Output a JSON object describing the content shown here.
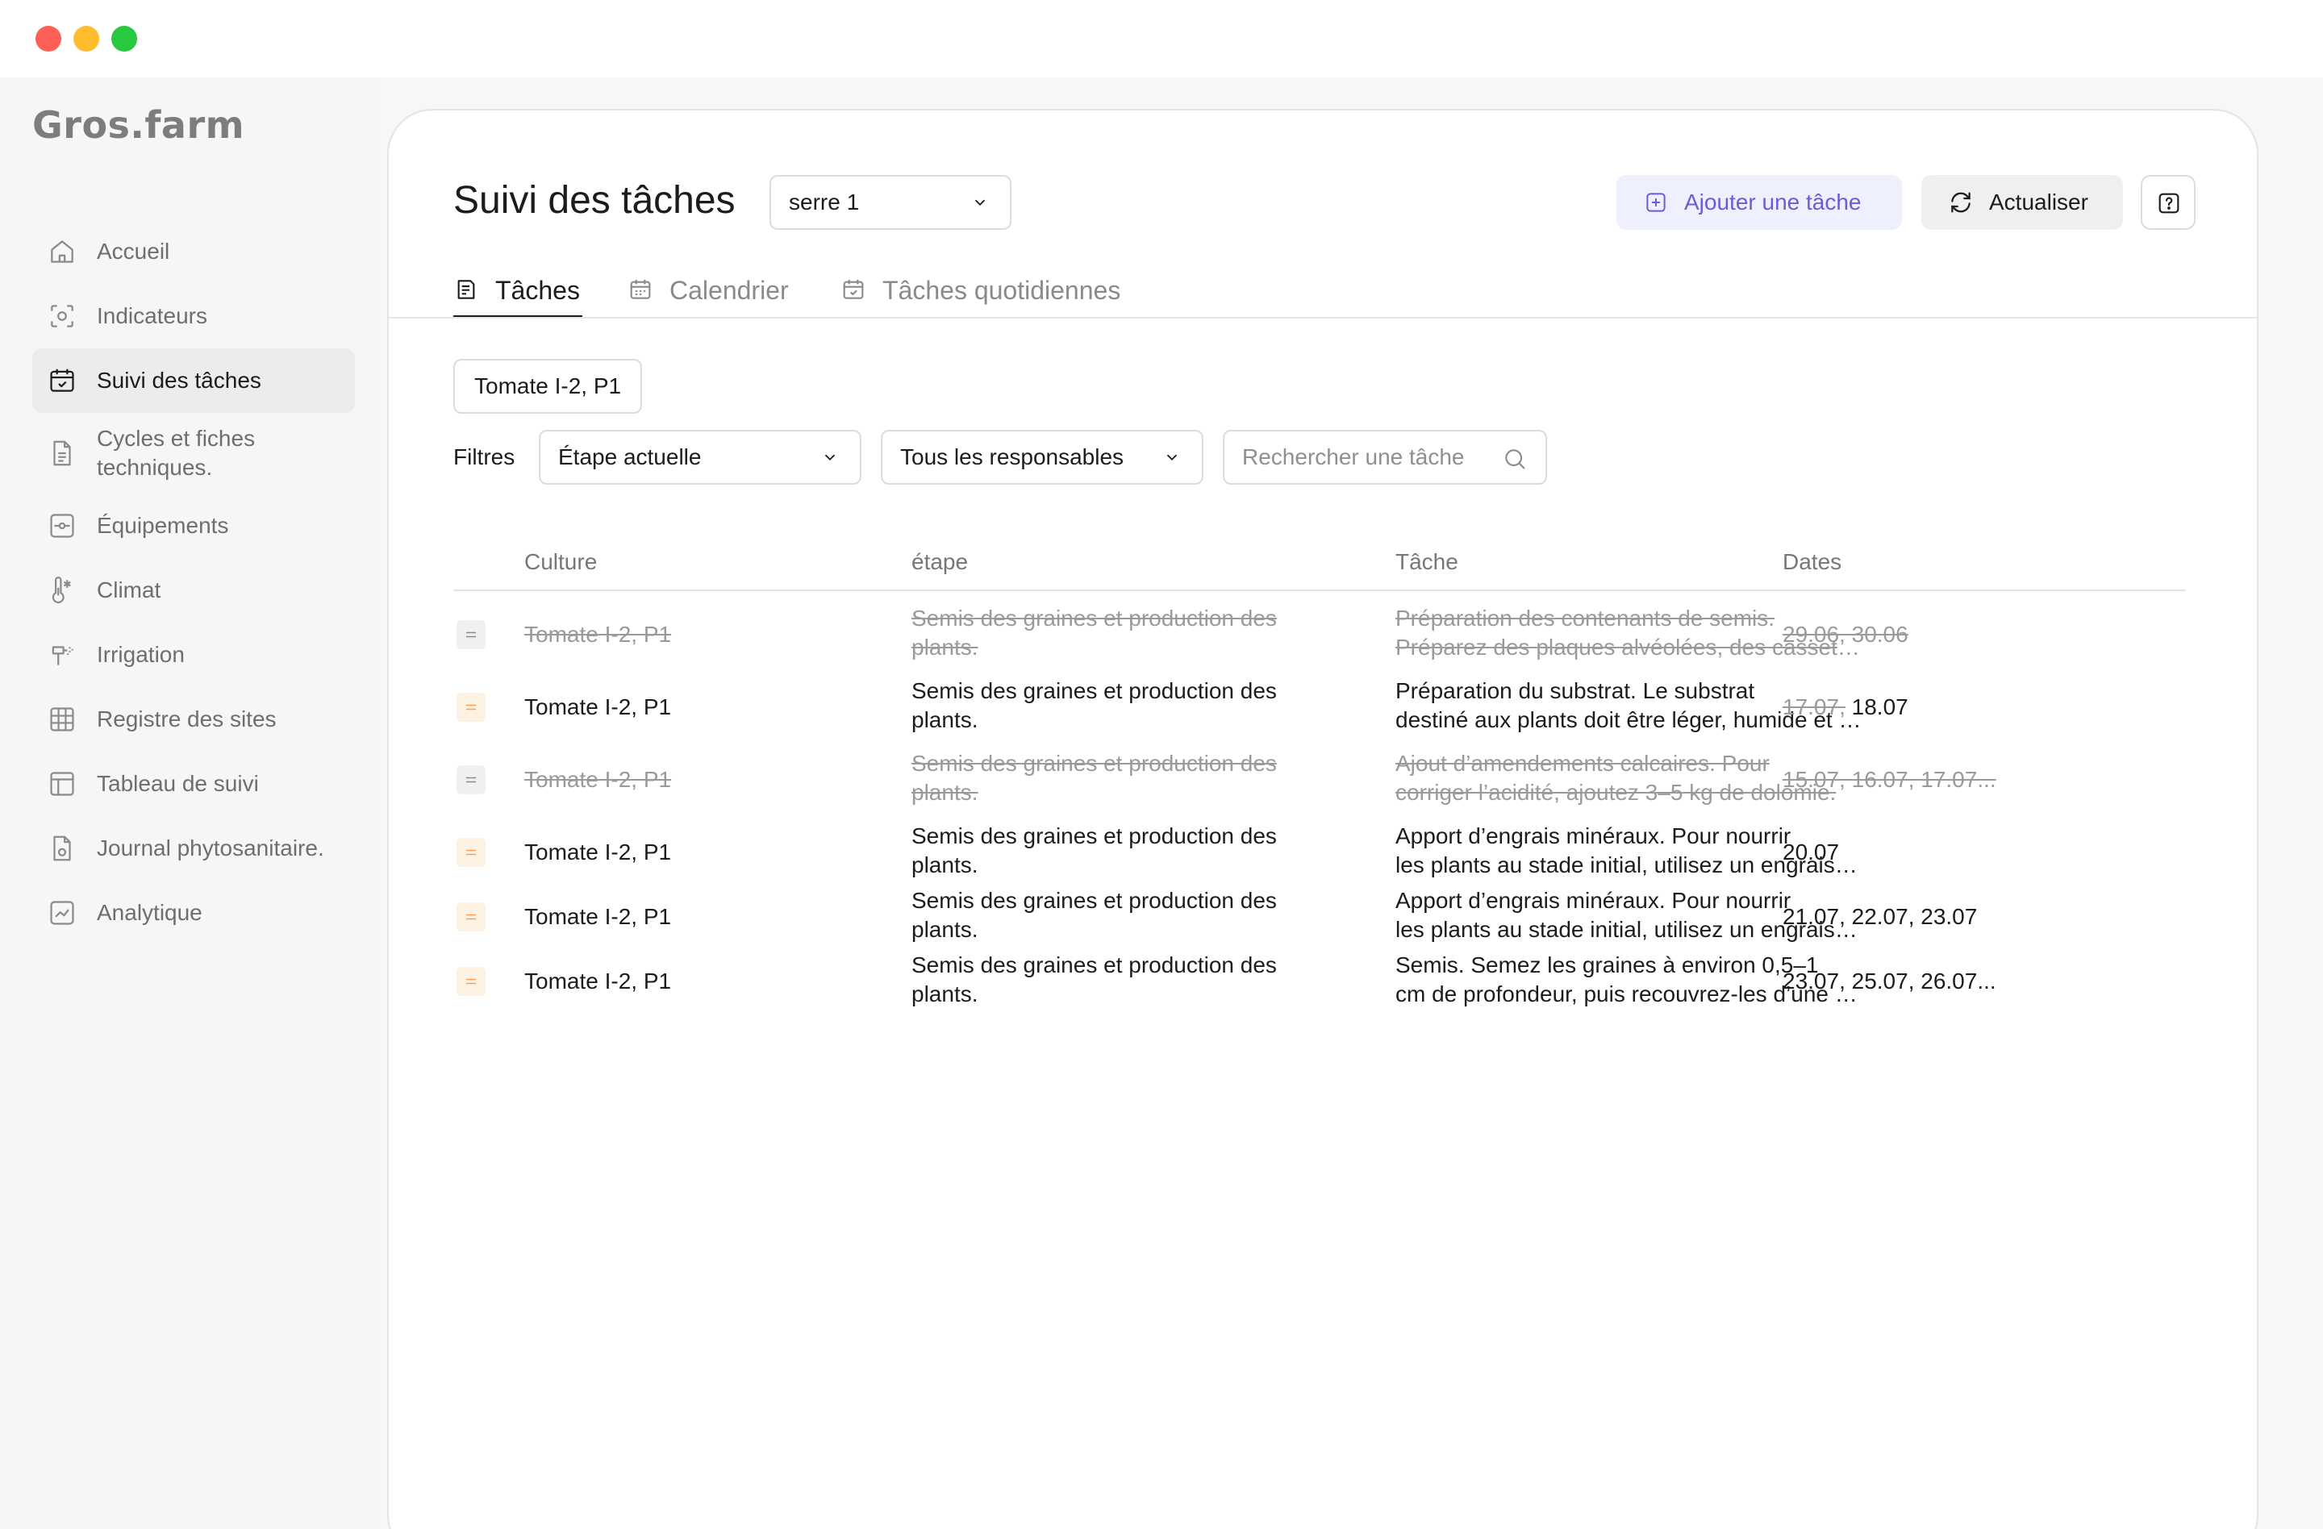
{
  "app": {
    "logo": "Gros.farm"
  },
  "sidebar": {
    "items": [
      {
        "label": "Accueil",
        "icon": "home-icon",
        "active": false
      },
      {
        "label": "Indicateurs",
        "icon": "indicators-icon",
        "active": false
      },
      {
        "label": "Suivi des tâches",
        "icon": "calendar-check-icon",
        "active": true
      },
      {
        "label": "Cycles et fiches\ntechniques.",
        "icon": "document-icon",
        "active": false
      },
      {
        "label": "Équipements",
        "icon": "equipment-icon",
        "active": false
      },
      {
        "label": "Climat",
        "icon": "thermometer-icon",
        "active": false
      },
      {
        "label": "Irrigation",
        "icon": "irrigation-icon",
        "active": false
      },
      {
        "label": "Registre des sites",
        "icon": "grid-icon",
        "active": false
      },
      {
        "label": "Tableau de suivi",
        "icon": "table-icon",
        "active": false
      },
      {
        "label": "Journal phytosanitaire.",
        "icon": "journal-icon",
        "active": false
      },
      {
        "label": "Analytique",
        "icon": "chart-icon",
        "active": false
      }
    ]
  },
  "header": {
    "title": "Suivi des tâches",
    "site_select": "serre 1",
    "add_task": "Ajouter une tâche",
    "refresh": "Actualiser",
    "help_icon": "help-icon"
  },
  "tabs": [
    {
      "label": "Tâches",
      "active": true
    },
    {
      "label": "Calendrier",
      "active": false
    },
    {
      "label": "Tâches quotidiennes",
      "active": false
    }
  ],
  "crop_chip": "Tomate I-2, P1",
  "filters": {
    "label": "Filtres",
    "stage": "Étape actuelle",
    "responsible": "Tous les responsables",
    "search_placeholder": "Rechercher une tâche"
  },
  "table": {
    "columns": [
      "Culture",
      "étape",
      "Tâche",
      "Dates"
    ],
    "rows": [
      {
        "done": true,
        "handle_color": "gray",
        "culture": "Tomate I-2, P1",
        "stage": "Semis des graines et production des plants.",
        "task_line1": "Préparation des contenants de semis.",
        "task_line2": "Préparez des plaques alvéolées, des cassettes ou des pots.",
        "dates_struck": "29.06, 30.06",
        "dates": ""
      },
      {
        "done": false,
        "handle_color": "orange",
        "culture": "Tomate I-2, P1",
        "stage": "Semis des graines et production des plants.",
        "task_line1": "Préparation du substrat. Le substrat",
        "task_line2": "destiné aux plants doit être léger, humide et fertile.",
        "dates_struck": "17.07,",
        "dates": "18.07"
      },
      {
        "done": true,
        "handle_color": "gray",
        "culture": "Tomate I-2, P1",
        "stage": "Semis des graines et production des plants.",
        "task_line1": "Ajout d’amendements calcaires. Pour",
        "task_line2": "corriger l’acidité, ajoutez 3–5 kg de dolomie.",
        "dates_struck": "15.07, 16.07, 17.07...",
        "dates": ""
      },
      {
        "done": false,
        "handle_color": "orange",
        "culture": "Tomate I-2, P1",
        "stage": "Semis des graines et production des plants.",
        "task_line1": "Apport d’engrais minéraux. Pour nourrir",
        "task_line2": "les plants au stade initial, utilisez un engrais complexe.",
        "dates_struck": "",
        "dates": "20.07"
      },
      {
        "done": false,
        "handle_color": "orange",
        "culture": "Tomate I-2, P1",
        "stage": "Semis des graines et production des plants.",
        "task_line1": "Apport d’engrais minéraux. Pour nourrir",
        "task_line2": "les plants au stade initial, utilisez un engrais complexe.",
        "dates_struck": "",
        "dates": "21.07, 22.07, 23.07"
      },
      {
        "done": false,
        "handle_color": "orange",
        "culture": "Tomate I-2, P1",
        "stage": "Semis des graines et production des plants.",
        "task_line1": "Semis. Semez les graines à environ 0,5–1",
        "task_line2": "cm de profondeur, puis recouvrez-les d’une fine couche.",
        "dates_struck": "",
        "dates": "23.07, 25.07, 26.07..."
      }
    ]
  },
  "colors": {
    "accent": "#6a5bd8",
    "accent_bg": "#eef0fd",
    "done_text": "#9a9a9a",
    "handle_orange": "#f2a356"
  }
}
